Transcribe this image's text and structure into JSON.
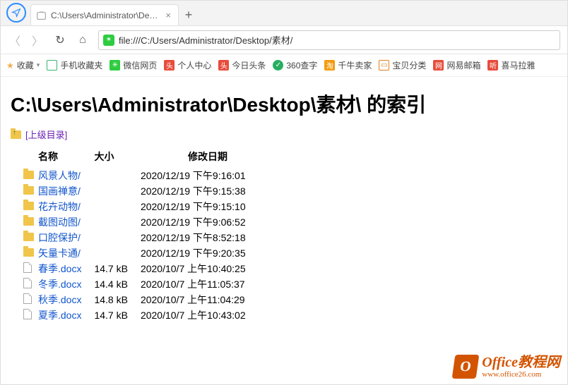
{
  "tab": {
    "title": "C:\\Users\\Administrator\\Deskt"
  },
  "addressbar": {
    "url": "file:///C:/Users/Administrator/Desktop/素材/"
  },
  "bookmarks": {
    "fav_label": "收藏",
    "items": [
      {
        "label": "手机收藏夹",
        "color": "#3cb371"
      },
      {
        "label": "微信网页",
        "color": "#2ecc40"
      },
      {
        "label": "个人中心",
        "color": "#e74c3c"
      },
      {
        "label": "今日头条",
        "color": "#e74c3c"
      },
      {
        "label": "360查字",
        "color": "#27ae60"
      },
      {
        "label": "千牛卖家",
        "color": "#f39c12"
      },
      {
        "label": "宝贝分类",
        "color": "#e67e22"
      },
      {
        "label": "网易邮箱",
        "color": "#e74c3c"
      },
      {
        "label": "喜马拉雅",
        "color": "#e74c3c"
      }
    ]
  },
  "page": {
    "heading": "C:\\Users\\Administrator\\Desktop\\素材\\ 的索引",
    "parent_label": "[上级目录]",
    "columns": {
      "name": "名称",
      "size": "大小",
      "date": "修改日期"
    },
    "rows": [
      {
        "type": "dir",
        "name": "风景人物/",
        "size": "",
        "date": "2020/12/19 下午9:16:01"
      },
      {
        "type": "dir",
        "name": "国画禅意/",
        "size": "",
        "date": "2020/12/19 下午9:15:38"
      },
      {
        "type": "dir",
        "name": "花卉动物/",
        "size": "",
        "date": "2020/12/19 下午9:15:10"
      },
      {
        "type": "dir",
        "name": "截图动图/",
        "size": "",
        "date": "2020/12/19 下午9:06:52"
      },
      {
        "type": "dir",
        "name": "口腔保护/",
        "size": "",
        "date": "2020/12/19 下午8:52:18"
      },
      {
        "type": "dir",
        "name": "矢量卡通/",
        "size": "",
        "date": "2020/12/19 下午9:20:35"
      },
      {
        "type": "file",
        "name": "春季.docx",
        "size": "14.7 kB",
        "date": "2020/10/7 上午10:40:25"
      },
      {
        "type": "file",
        "name": "冬季.docx",
        "size": "14.4 kB",
        "date": "2020/10/7 上午11:05:37"
      },
      {
        "type": "file",
        "name": "秋季.docx",
        "size": "14.8 kB",
        "date": "2020/10/7 上午11:04:29"
      },
      {
        "type": "file",
        "name": "夏季.docx",
        "size": "14.7 kB",
        "date": "2020/10/7 上午10:43:02"
      }
    ]
  },
  "watermark": {
    "line1": "Office教程网",
    "line2": "www.office26.com"
  }
}
